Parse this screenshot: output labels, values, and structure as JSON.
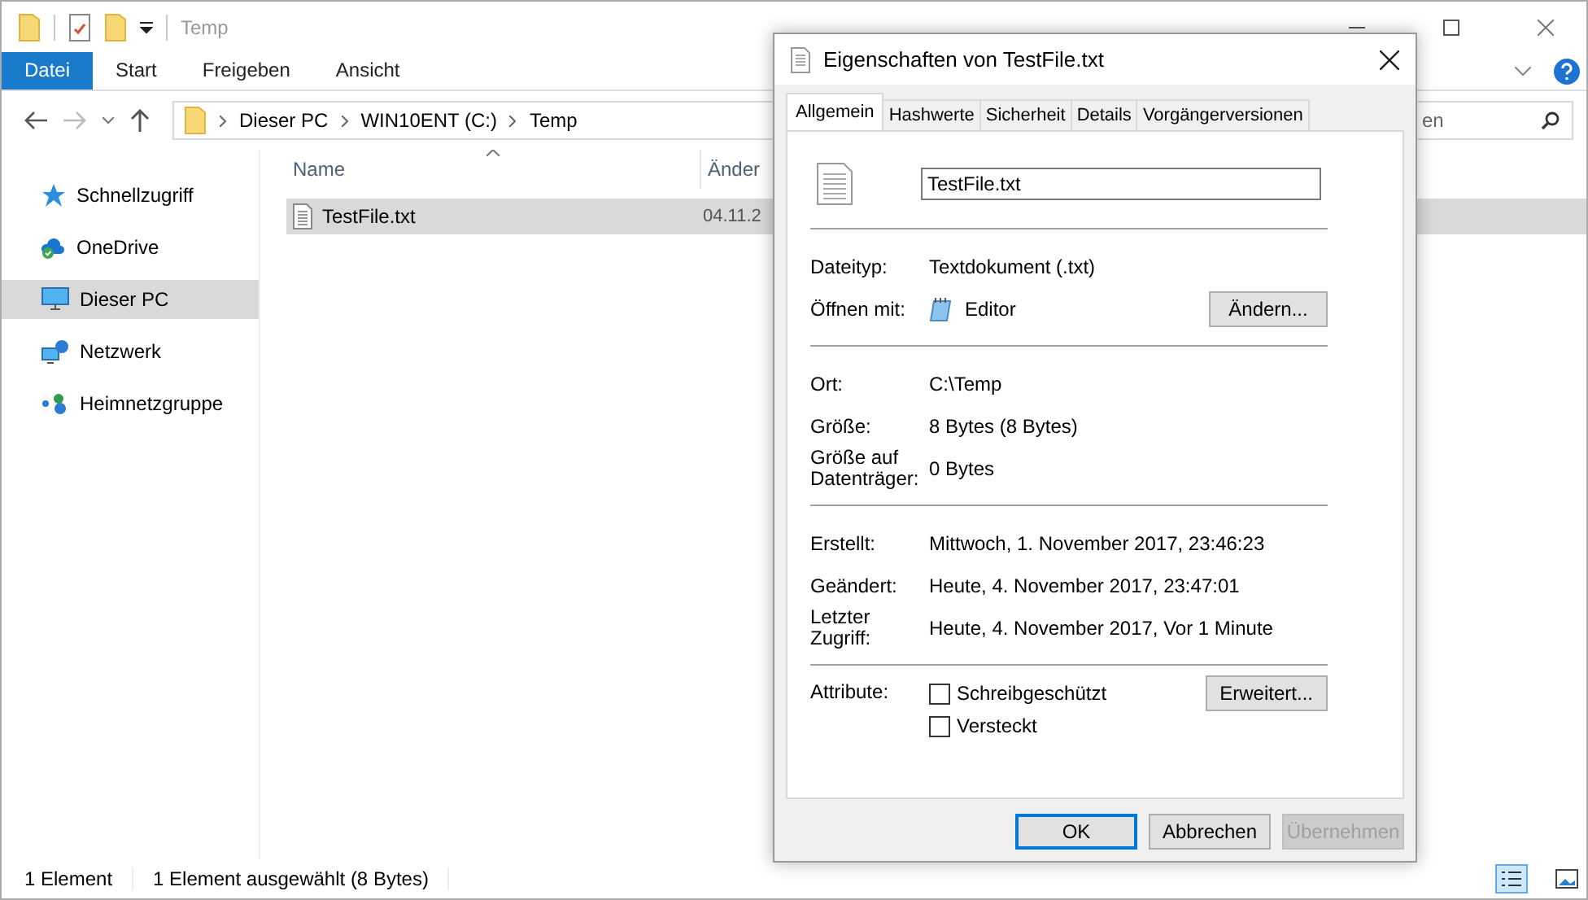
{
  "window": {
    "title": "Temp"
  },
  "ribbon_tabs": [
    {
      "label": "Datei",
      "selected": true
    },
    {
      "label": "Start",
      "selected": false
    },
    {
      "label": "Freigeben",
      "selected": false
    },
    {
      "label": "Ansicht",
      "selected": false
    }
  ],
  "address_bar": {
    "path": [
      "Dieser PC",
      "WIN10ENT (C:)",
      "Temp"
    ]
  },
  "search": {
    "placeholder": "en"
  },
  "sidebar": {
    "items": [
      {
        "label": "Schnellzugriff",
        "selected": false
      },
      {
        "label": "OneDrive",
        "selected": false
      },
      {
        "label": "Dieser PC",
        "selected": true
      },
      {
        "label": "Netzwerk",
        "selected": false
      },
      {
        "label": "Heimnetzgruppe",
        "selected": false
      }
    ]
  },
  "file_list": {
    "columns": [
      "Name",
      "Änder"
    ],
    "rows": [
      {
        "name": "TestFile.txt",
        "date": "04.11.2",
        "selected": true
      }
    ]
  },
  "status_bar": {
    "count": "1 Element",
    "selection": "1 Element ausgewählt (8 Bytes)"
  },
  "dialog": {
    "title": "Eigenschaften von TestFile.txt",
    "tabs": [
      {
        "label": "Allgemein",
        "selected": true
      },
      {
        "label": "Hashwerte",
        "selected": false
      },
      {
        "label": "Sicherheit",
        "selected": false
      },
      {
        "label": "Details",
        "selected": false
      },
      {
        "label": "Vorgängerversionen",
        "selected": false
      }
    ],
    "file_name": "TestFile.txt",
    "sections": [
      {
        "rows": [
          {
            "kind": "text",
            "label": "Dateityp:",
            "value": "Textdokument (.txt)"
          },
          {
            "kind": "app",
            "label": "Öffnen mit:",
            "value": "Editor",
            "button": "Ändern..."
          }
        ]
      },
      {
        "rows": [
          {
            "kind": "text",
            "label": "Ort:",
            "value": "C:\\Temp"
          },
          {
            "kind": "text",
            "label": "Größe:",
            "value": "8 Bytes (8 Bytes)"
          },
          {
            "kind": "text",
            "label": "Größe auf Datenträger:",
            "value": "0 Bytes"
          }
        ]
      },
      {
        "rows": [
          {
            "kind": "text",
            "label": "Erstellt:",
            "value": "Mittwoch, 1. November 2017, 23:46:23"
          },
          {
            "kind": "text",
            "label": "Geändert:",
            "value": "Heute, 4. November 2017, 23:47:01"
          },
          {
            "kind": "text",
            "label": "Letzter Zugriff:",
            "value": "Heute, 4. November 2017, Vor 1 Minute"
          }
        ]
      }
    ],
    "attributes": {
      "label": "Attribute:",
      "checkboxes": [
        {
          "label": "Schreibgeschützt",
          "checked": false
        },
        {
          "label": "Versteckt",
          "checked": false
        }
      ],
      "button": "Erweitert..."
    },
    "buttons": [
      {
        "label": "OK",
        "kind": "default",
        "disabled": false
      },
      {
        "label": "Abbrechen",
        "kind": "normal",
        "disabled": false
      },
      {
        "label": "Übernehmen",
        "kind": "normal",
        "disabled": true
      }
    ]
  }
}
